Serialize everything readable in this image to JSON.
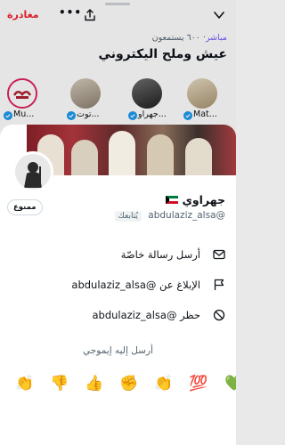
{
  "space": {
    "leave_label": "مغادرة",
    "more_label": "•••",
    "live_word": "مباشر",
    "listeners_label": "٦٠٠ يستمعون",
    "title": "عيش وملح اليكتروني",
    "speakers": [
      {
        "name": "Mu...",
        "verified": true,
        "avatar_color": "#b0232e"
      },
      {
        "name": "توت...",
        "verified": true,
        "avatar_color": "#8b7f70"
      },
      {
        "name": "جهراو...",
        "verified": true,
        "avatar_color": "#2d2d2d"
      },
      {
        "name": "Mat...",
        "verified": true,
        "avatar_color": "#c9b99a"
      }
    ]
  },
  "profile": {
    "display_name": "جهراوي",
    "handle": "@abdulaziz_alsa",
    "follows_you_label": "يُتابعك",
    "blocked_label": "ممنوع"
  },
  "actions": [
    {
      "label": "أرسل رسالة خاصّة",
      "icon": "envelope-icon"
    },
    {
      "label": "الإبلاغ عن @abdulaziz_alsa",
      "icon": "flag-icon"
    },
    {
      "label": "حظر @abdulaziz_alsa",
      "icon": "block-icon"
    }
  ],
  "emoji_prompt": "أرسل إليه إيموجي",
  "emojis": [
    "👏",
    "👎",
    "👍",
    "✊",
    "👏",
    "💯",
    "💚"
  ],
  "colors": {
    "accent": "#1d9bf0",
    "leave": "#f4212e",
    "live": "#7856ff",
    "text": "#0f1419",
    "muted": "#536471"
  }
}
